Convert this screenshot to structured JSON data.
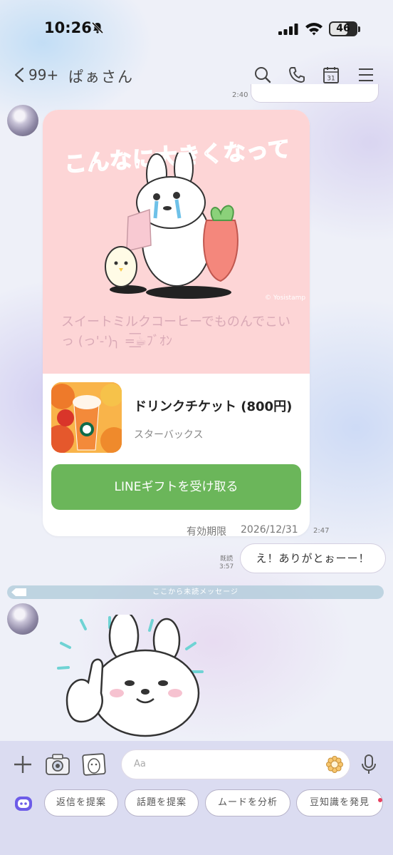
{
  "status_bar": {
    "time": "10:26",
    "battery": "46"
  },
  "header": {
    "unread_count": "99+",
    "chat_name": "ぱぁさん",
    "calendar_day": "31"
  },
  "messages": {
    "top_time": "2:40",
    "sticker": {
      "title": "こんなに大きくなって",
      "copyright": "© Yosistamp",
      "message": "スイートミルクコーヒーでものんでこいっ (っ'-')╮ =͟͟͞͞☕ﾌﾞｵﾝ"
    },
    "gift": {
      "product_name": "ドリンクチケット (800円)",
      "shop": "スターバックス",
      "button_label": "LINEギフトを受け取る",
      "expiry_label": "有効期限",
      "expiry_date": "2026/12/31",
      "time": "2:47"
    },
    "sent": {
      "text": "え！ありがとぉーー！",
      "read_label": "既読",
      "time": "3:57"
    },
    "unread_divider": "ここから未読メッセージ"
  },
  "input_bar": {
    "placeholder": "Aa",
    "chips": [
      "返信を提案",
      "話題を提案",
      "ムードを分析",
      "豆知識を発見"
    ]
  },
  "colors": {
    "gift_button": "#6bb65a",
    "sticker_bg": "#fdd5d6"
  }
}
